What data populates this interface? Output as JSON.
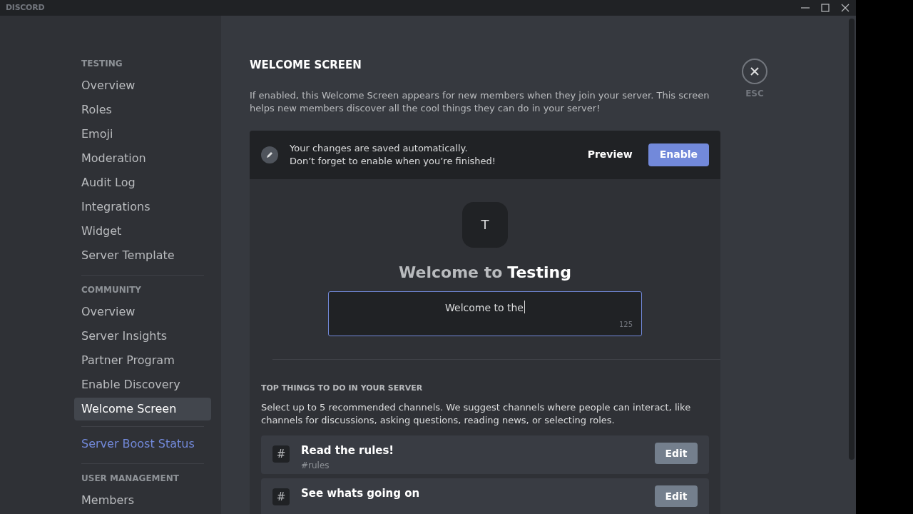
{
  "window": {
    "title": "DISCORD"
  },
  "sidebar": {
    "sections": [
      {
        "header": "TESTING",
        "items": [
          {
            "label": "Overview",
            "kind": "item",
            "selected": false
          },
          {
            "label": "Roles",
            "kind": "item",
            "selected": false
          },
          {
            "label": "Emoji",
            "kind": "item",
            "selected": false
          },
          {
            "label": "Moderation",
            "kind": "item",
            "selected": false
          },
          {
            "label": "Audit Log",
            "kind": "item",
            "selected": false
          },
          {
            "label": "Integrations",
            "kind": "item",
            "selected": false
          },
          {
            "label": "Widget",
            "kind": "item",
            "selected": false
          },
          {
            "label": "Server Template",
            "kind": "item",
            "selected": false
          }
        ]
      },
      {
        "header": "COMMUNITY",
        "items": [
          {
            "label": "Overview",
            "kind": "item",
            "selected": false
          },
          {
            "label": "Server Insights",
            "kind": "item",
            "selected": false
          },
          {
            "label": "Partner Program",
            "kind": "item",
            "selected": false
          },
          {
            "label": "Enable Discovery",
            "kind": "item",
            "selected": false
          },
          {
            "label": "Welcome Screen",
            "kind": "item",
            "selected": true
          },
          {
            "label": "Server Boost Status",
            "kind": "boost",
            "selected": false
          }
        ]
      },
      {
        "header": "USER MANAGEMENT",
        "items": [
          {
            "label": "Members",
            "kind": "item",
            "selected": false
          }
        ]
      }
    ]
  },
  "page": {
    "title": "WELCOME SCREEN",
    "description": "If enabled, this Welcome Screen appears for new members when they join your server. This screen helps new members discover all the cool things they can do in your server!",
    "close_label": "ESC"
  },
  "notice": {
    "lines": [
      "Your changes are saved automatically.",
      "Don’t forget to enable when you’re finished!"
    ],
    "preview_button": "Preview",
    "enable_button": "Enable"
  },
  "preview": {
    "server_initial": "T",
    "welcome_prefix": "Welcome to",
    "server_name": "Testing",
    "description_value": "Welcome to the",
    "char_count": "125"
  },
  "top_things": {
    "heading": "TOP THINGS TO DO IN YOUR SERVER",
    "description": "Select up to 5 recommended channels. We suggest channels where people can interact, like channels for discussions, asking questions, reading news, or selecting roles.",
    "channels": [
      {
        "icon": "#",
        "title": "Read the rules!",
        "channel": "#rules",
        "edit_button": "Edit"
      },
      {
        "icon": "#",
        "title": "See whats going on",
        "edit_button": "Edit"
      }
    ]
  }
}
